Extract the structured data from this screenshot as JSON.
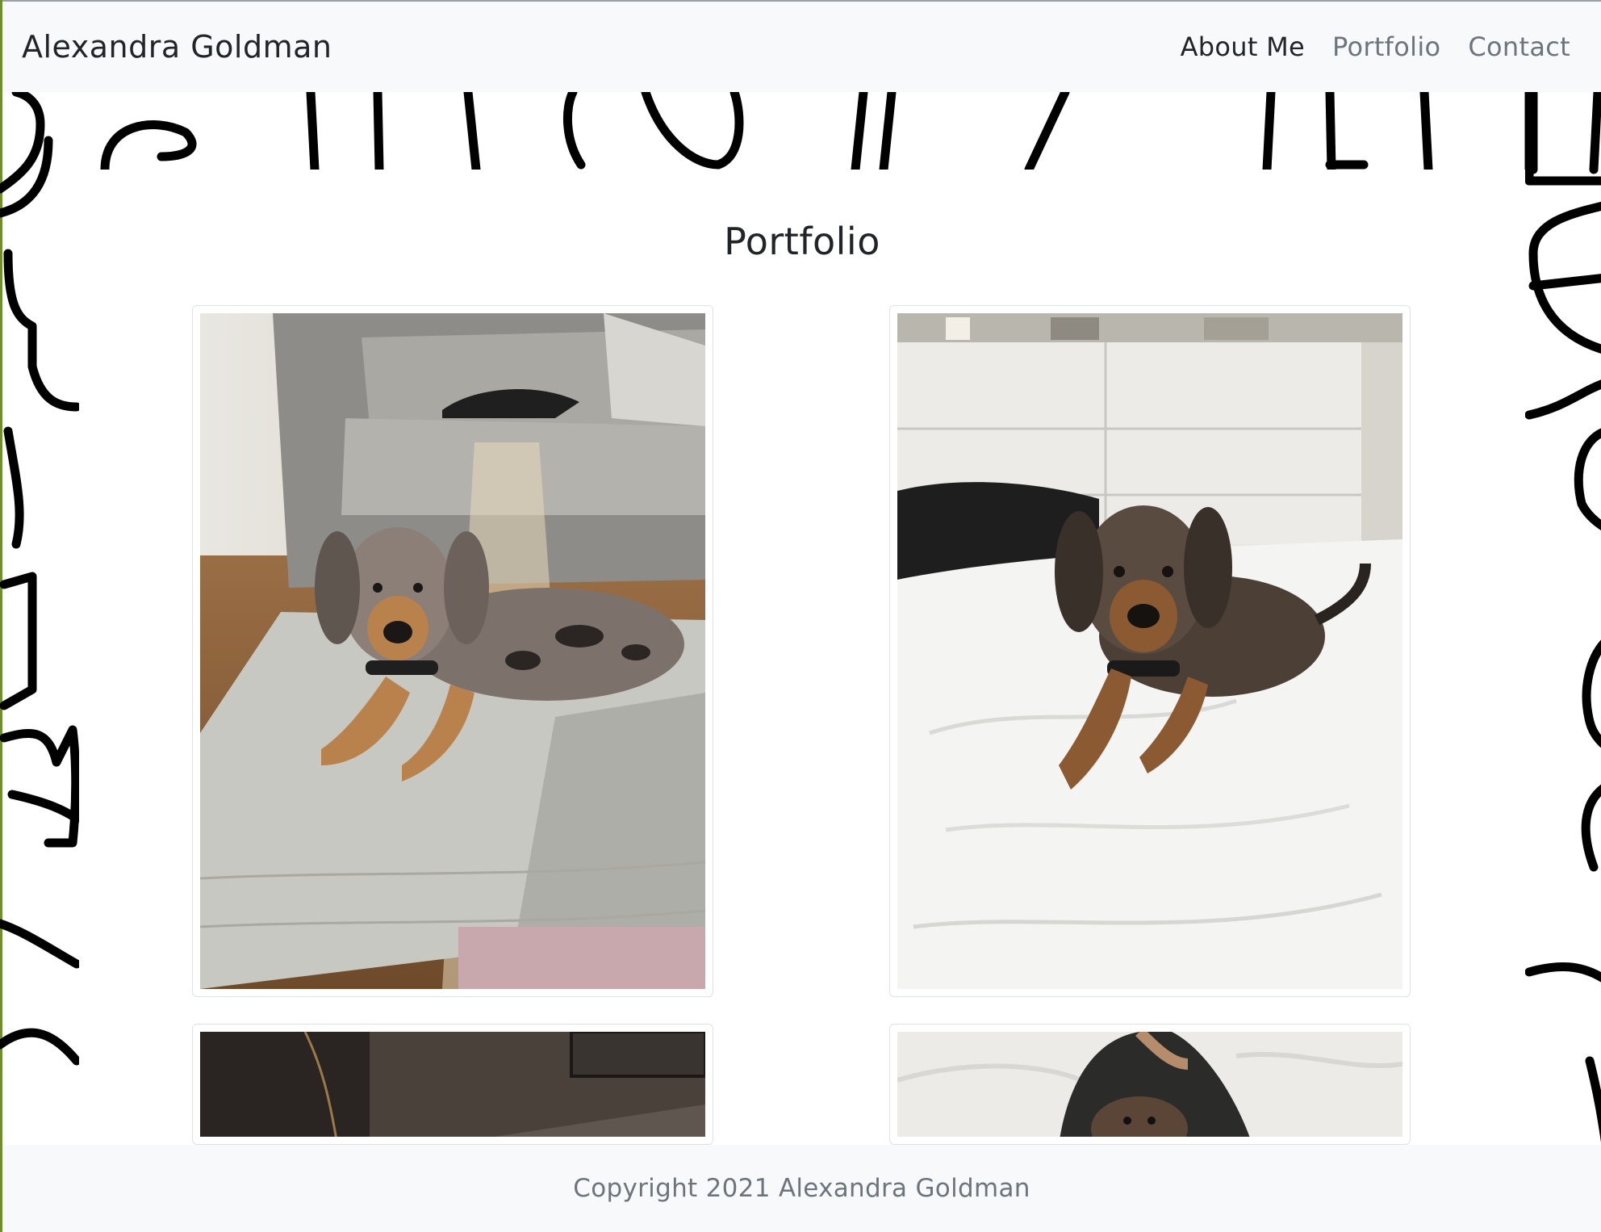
{
  "navbar": {
    "brand": "Alexandra Goldman",
    "links": [
      {
        "label": "About Me",
        "active": true
      },
      {
        "label": "Portfolio",
        "active": false
      },
      {
        "label": "Contact",
        "active": false
      }
    ]
  },
  "main": {
    "title": "Portfolio",
    "photos": [
      {
        "subject": "dapple dachshund lying on a cushion"
      },
      {
        "subject": "dapple dachshund sitting on a white bed"
      },
      {
        "subject": "dark room photo (partially visible)"
      },
      {
        "subject": "dachshund on bed (partially visible)"
      }
    ]
  },
  "footer": {
    "text": "Copyright 2021 Alexandra Goldman"
  },
  "colors": {
    "navbar_bg": "#f8f9fa",
    "text_dark": "#212529",
    "text_muted": "#6c757d",
    "border": "#dee2e6"
  }
}
